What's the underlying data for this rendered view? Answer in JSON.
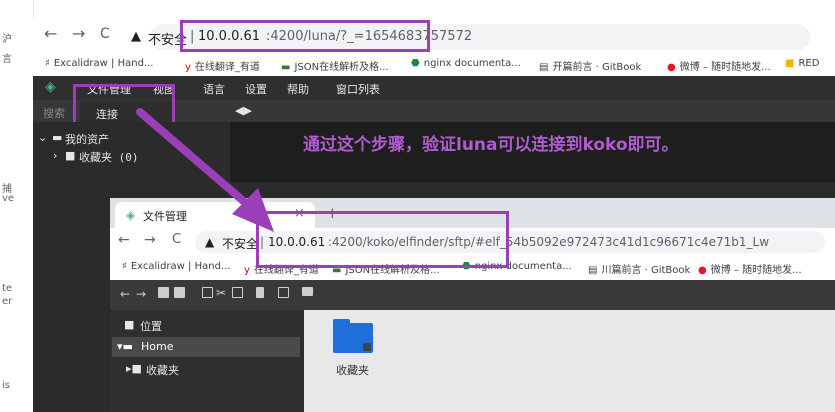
{
  "colors": {
    "annotation": "#9b3fb8",
    "dark_bg": "#2b2b2b",
    "menu_bg": "#2f2f2f",
    "folder_blue": "#1e6fd9"
  },
  "left_strip": {
    "c1": "沪",
    "c2": "言",
    "c3": "捕",
    "c4": "ve",
    "c5": "te",
    "c6": "er",
    "c7": "is"
  },
  "browser1": {
    "nav": {
      "back": "←",
      "forward": "→",
      "reload": "C"
    },
    "security_label": "不安全",
    "url_host": "10.0.0.61",
    "url_rest": ":4200/luna/?_=1654683757572",
    "bookmarks": [
      {
        "icon": "excalidraw-icon",
        "label": "Excalidraw | Hand..."
      },
      {
        "icon": "youdao-icon",
        "label": "在线翻译_有道"
      },
      {
        "icon": "json-icon",
        "label": "JSON在线解析及格..."
      },
      {
        "icon": "nginx-icon",
        "label": "nginx documenta..."
      },
      {
        "icon": "book-icon",
        "label": "开篇前言 · GitBook"
      },
      {
        "icon": "weibo-icon",
        "label": "微博 – 随时随地发..."
      },
      {
        "icon": "folder-icon",
        "label": "RED"
      }
    ]
  },
  "luna": {
    "menu": [
      "文件管理",
      "视图",
      "语言",
      "设置",
      "帮助",
      "窗口列表"
    ],
    "search_placeholder": "搜索",
    "dropdown_item": "连接",
    "tree_root": "我的资产",
    "tree_child": "收藏夹 (0)",
    "annotation_text": "通过这个步骤，验证luna可以连接到koko即可。"
  },
  "browser2": {
    "tab_title": "文件管理",
    "tab_close": "×",
    "new_tab": "+",
    "nav": {
      "back": "←",
      "forward": "→",
      "reload": "C"
    },
    "security_label": "不安全",
    "url_host": "10.0.0.61",
    "url_rest": ":4200/koko/elfinder/sftp/#elf_54b5092e972473c41d1c96671c4e71b1_Lw",
    "bookmarks": [
      {
        "label": "Excalidraw | Hand..."
      },
      {
        "label": "在线翻译_有道"
      },
      {
        "label": "JSON在线解析及格..."
      },
      {
        "label": "nginx documenta..."
      },
      {
        "label": "川篇前言 · GitBook"
      },
      {
        "label": "微博 – 随时随地发..."
      }
    ]
  },
  "elfinder": {
    "places": "位置",
    "home": "Home",
    "favorites": "收藏夹",
    "folder_label": "收藏夹"
  }
}
